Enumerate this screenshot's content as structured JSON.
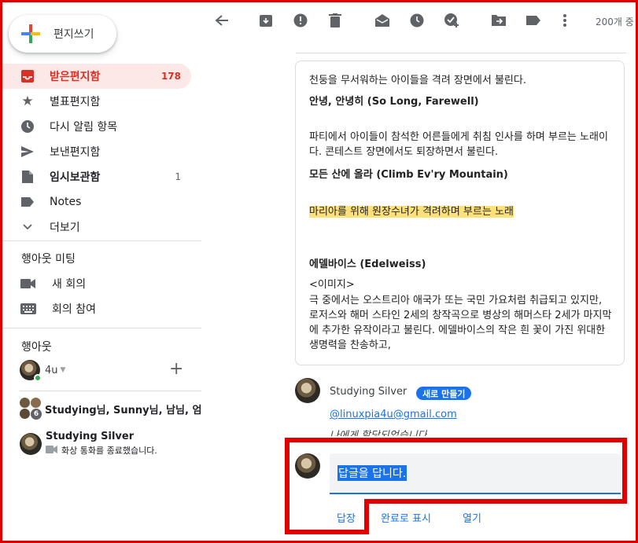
{
  "compose": {
    "label": "편지쓰기"
  },
  "nav": {
    "items": [
      {
        "label": "받은편지함",
        "count": "178",
        "icon": "inbox-icon"
      },
      {
        "label": "별표편지함",
        "count": "",
        "icon": "star-icon"
      },
      {
        "label": "다시 알림 항목",
        "count": "",
        "icon": "clock-icon"
      },
      {
        "label": "보낸편지함",
        "count": "",
        "icon": "send-icon"
      },
      {
        "label": "임시보관함",
        "count": "1",
        "icon": "draft-icon"
      },
      {
        "label": "Notes",
        "count": "",
        "icon": "label-icon"
      },
      {
        "label": "더보기",
        "count": "",
        "icon": "chevron-down-icon"
      }
    ]
  },
  "meet": {
    "title": "행아웃 미팅",
    "new_meeting": "새 회의",
    "join_meeting": "회의 참여"
  },
  "hangouts": {
    "title": "행아웃",
    "user": "4u",
    "group_chat": "Studying님, Sunny님, 남님, 엄",
    "group_count": "6",
    "contact_name": "Studying Silver",
    "contact_status": "화상 통화를 종료했습니다."
  },
  "toolbar": {
    "page_info": "200개 중"
  },
  "message": {
    "line1": "천둥을 무서워하는 아이들을 격려 장면에서 불린다.",
    "song1": "안녕, 안녕히 (So Long, Farewell)",
    "desc1": "파티에서 아이들이 참석한 어른들에게 취침 인사를 하며 부르는 노래이다. 콘테스트 장면에서도 퇴장하면서 불린다.",
    "song2": "모든 산에 올라 (Climb Ev'ry Mountain)",
    "highlight": "마리아를 위해 원장수녀가 격려하며 부르는 노래",
    "song3": "에델바이스 (Edelweiss)",
    "image_tag": "<이미지>",
    "desc3": "극 중에서는 오스트리아 애국가 또는 국민 가요처럼 취급되고 있지만, 로저스와 해머 스타인 2세의 창작곡으로 병상의 해머스타 2세가 마지막에 추가한 유작이라고 불린다. 에델바이스의 작은 흰 꽃이 가진 위대한 생명력을 찬송하고,"
  },
  "comment": {
    "sender": "Studying Silver",
    "badge": "새로 만들기",
    "mention": "@linuxpia4u@gmail.com",
    "assigned": "나에게 할당되었습니다"
  },
  "reply": {
    "placeholder": "답글을 답니다.",
    "reply_action": "답장",
    "mark_done": "완료로 표시",
    "open": "열기"
  }
}
